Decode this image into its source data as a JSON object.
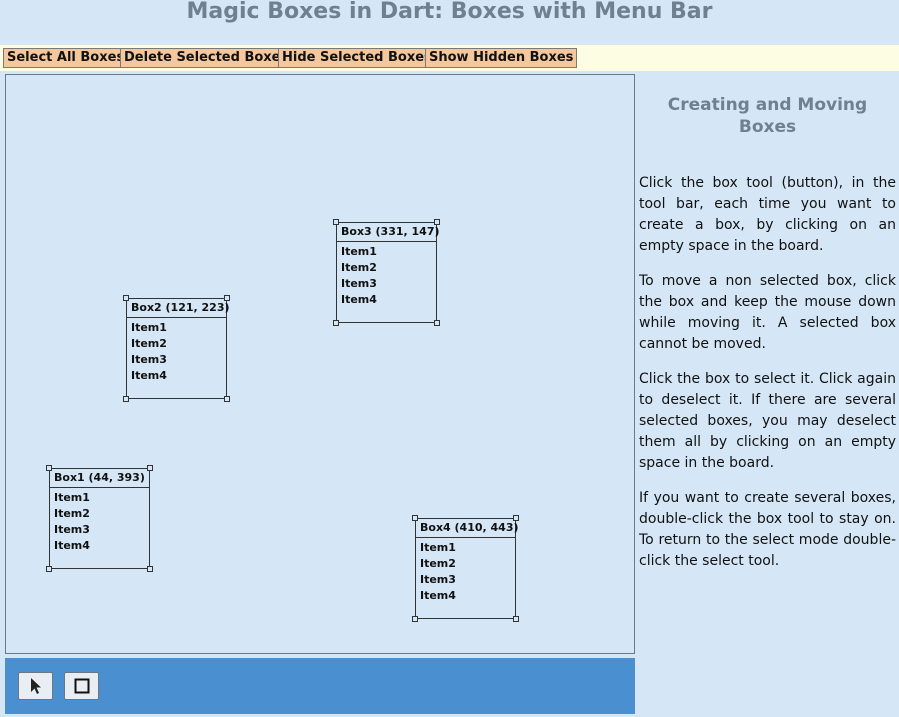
{
  "header": {
    "title": "Magic Boxes in Dart: Boxes with Menu Bar"
  },
  "menu": {
    "select_all": "Select All Boxes",
    "delete_selected": "Delete Selected Boxes",
    "hide_selected": "Hide Selected Boxes",
    "show_hidden": "Show Hidden Boxes"
  },
  "boxes": [
    {
      "title": "Box1 (44, 393)",
      "items": [
        "Item1",
        "Item2",
        "Item3",
        "Item4"
      ]
    },
    {
      "title": "Box2 (121, 223)",
      "items": [
        "Item1",
        "Item2",
        "Item3",
        "Item4"
      ]
    },
    {
      "title": "Box3 (331, 147)",
      "items": [
        "Item1",
        "Item2",
        "Item3",
        "Item4"
      ]
    },
    {
      "title": "Box4 (410, 443)",
      "items": [
        "Item1",
        "Item2",
        "Item3",
        "Item4"
      ]
    }
  ],
  "toolbar": {
    "tools": [
      {
        "name": "select-tool",
        "icon": "arrow-cursor-icon"
      },
      {
        "name": "box-tool",
        "icon": "square-outline-icon"
      }
    ]
  },
  "sidebar": {
    "title": "Creating and Moving Boxes",
    "paragraphs": [
      "Click the box tool (button), in the tool bar, each time you want to create a box, by clicking on an empty space in the board.",
      "To move a non selected box, click the box and keep the mouse down while moving it. A selected box cannot be moved.",
      "Click the box to select it. Click again to deselect it. If there are several selected boxes, you may deselect them all by clicking on an empty space in the board.",
      "If you want to create several boxes, double-click the box tool to stay on. To return to the select mode double-click the select tool."
    ]
  },
  "colors": {
    "background": "#d5e7f7",
    "menu_bar": "#fdfde4",
    "menu_button": "#f5c79c",
    "toolbar": "#4a90d1",
    "title_text": "#6f8091"
  }
}
